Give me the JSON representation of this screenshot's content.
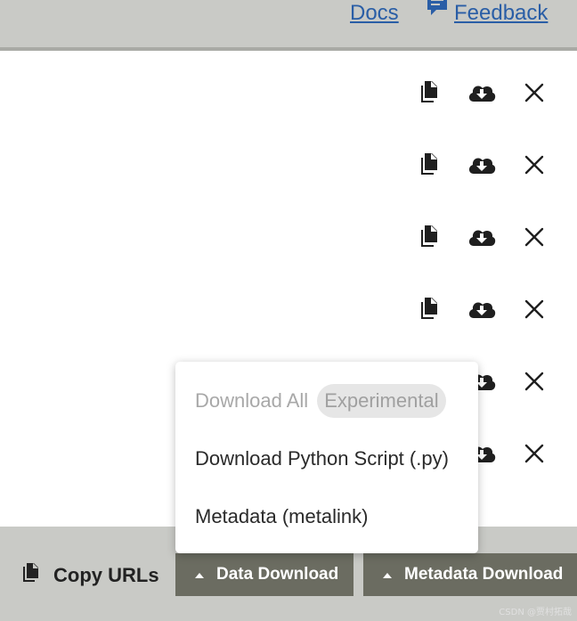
{
  "header": {
    "docs_label": "Docs",
    "feedback_label": "Feedback"
  },
  "rows": [
    {
      "copy_icon": "copy-icon",
      "download_icon": "cloud-download-icon",
      "remove_icon": "close-icon"
    },
    {
      "copy_icon": "copy-icon",
      "download_icon": "cloud-download-icon",
      "remove_icon": "close-icon"
    },
    {
      "copy_icon": "copy-icon",
      "download_icon": "cloud-download-icon",
      "remove_icon": "close-icon"
    },
    {
      "copy_icon": "copy-icon",
      "download_icon": "cloud-download-icon",
      "remove_icon": "close-icon"
    },
    {
      "copy_icon": "copy-icon",
      "download_icon": "cloud-download-icon",
      "remove_icon": "close-icon"
    },
    {
      "copy_icon": "copy-icon",
      "download_icon": "cloud-download-icon",
      "remove_icon": "close-icon"
    }
  ],
  "menu": {
    "items": [
      {
        "label": "Download All",
        "disabled": true,
        "badge": "Experimental"
      },
      {
        "label": "Download Python Script (.py)",
        "disabled": false
      },
      {
        "label": "Metadata (metalink)",
        "disabled": false
      }
    ]
  },
  "footer": {
    "copy_urls_label": "Copy URLs",
    "data_download_label": "Data Download",
    "metadata_download_label": "Metadata Download"
  },
  "colors": {
    "bar_background": "#c9cac6",
    "button_background": "#6b6c61",
    "link": "#2a5ea6"
  },
  "watermark": "CSDN @贾村拓哉"
}
